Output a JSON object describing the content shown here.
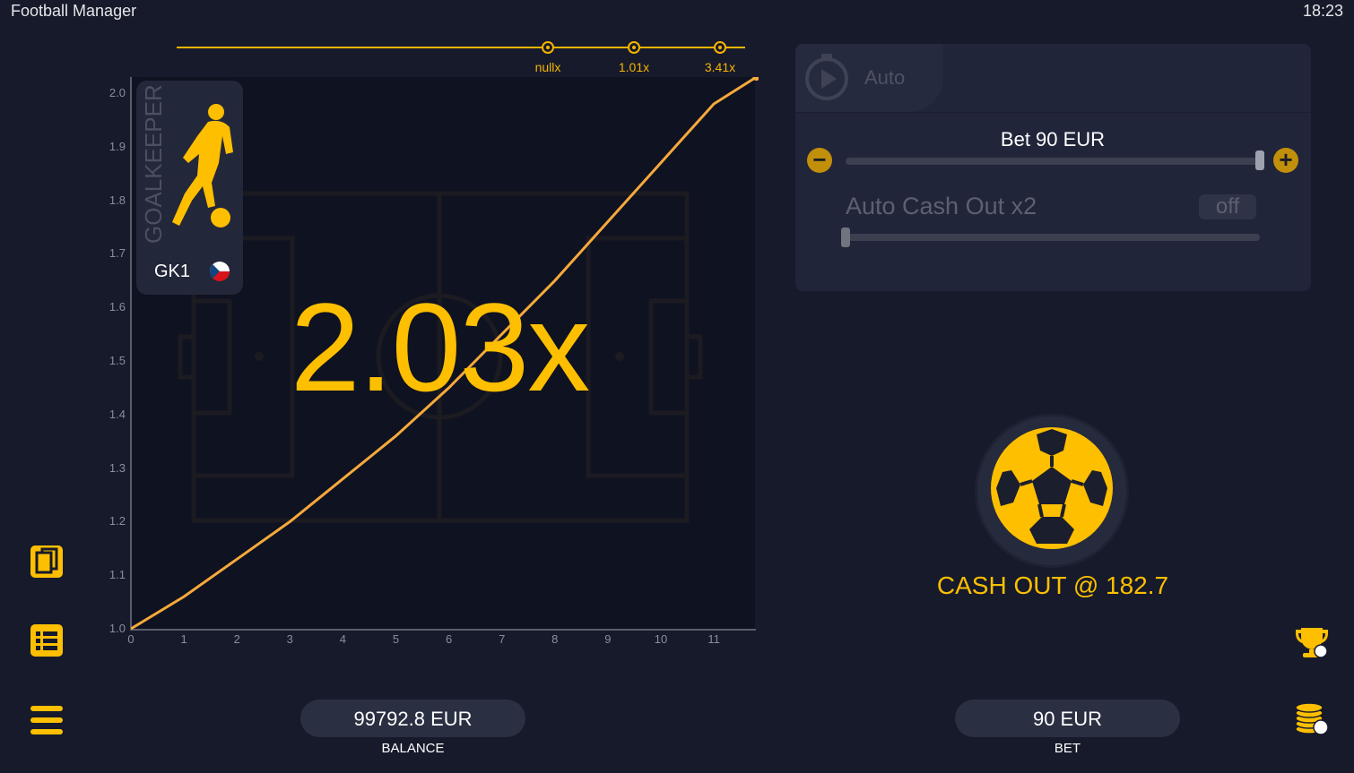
{
  "app": {
    "title": "Football Manager",
    "time": "18:23"
  },
  "history": [
    {
      "label": "nullx"
    },
    {
      "label": "1.01x"
    },
    {
      "label": "3.41x"
    }
  ],
  "game": {
    "multiplier": "2.03x"
  },
  "player": {
    "role": "GOALKEEPER",
    "name": "GK1",
    "flag": "czech-flag-icon"
  },
  "chart_data": {
    "type": "line",
    "x_ticks": [
      "0",
      "1",
      "2",
      "3",
      "4",
      "5",
      "6",
      "7",
      "8",
      "9",
      "10",
      "11"
    ],
    "y_ticks": [
      "1.0",
      "1.1",
      "1.2",
      "1.3",
      "1.4",
      "1.5",
      "1.6",
      "1.7",
      "1.8",
      "1.9",
      "2.0"
    ],
    "xlim": [
      0,
      11.8
    ],
    "ylim": [
      1.0,
      2.03
    ],
    "series": [
      {
        "x": [
          0,
          1,
          2,
          3,
          4,
          5,
          6,
          7,
          8,
          9,
          10,
          11,
          11.8
        ],
        "y": [
          1.0,
          1.06,
          1.13,
          1.2,
          1.28,
          1.36,
          1.45,
          1.55,
          1.65,
          1.76,
          1.87,
          1.98,
          2.03
        ]
      }
    ],
    "grid": false,
    "color": "#f6a93b"
  },
  "auto_panel": {
    "tab_label": "Auto",
    "bet_label": "Bet 90 EUR",
    "bet_slider_fraction": 1.0,
    "auto_cashout_label": "Auto Cash Out x2",
    "auto_cashout_toggle": "off",
    "auto_cashout_slider_fraction": 0.0,
    "minus_icon": "minus-icon",
    "plus_icon": "plus-icon"
  },
  "cashout": {
    "label": "CASH OUT @ 182.7"
  },
  "footer": {
    "balance_value": "99792.8 EUR",
    "balance_caption": "BALANCE",
    "bet_value": "90 EUR",
    "bet_caption": "BET"
  },
  "colors": {
    "accent": "#fdbf00",
    "background": "#161a2b",
    "panel": "#21253a"
  }
}
